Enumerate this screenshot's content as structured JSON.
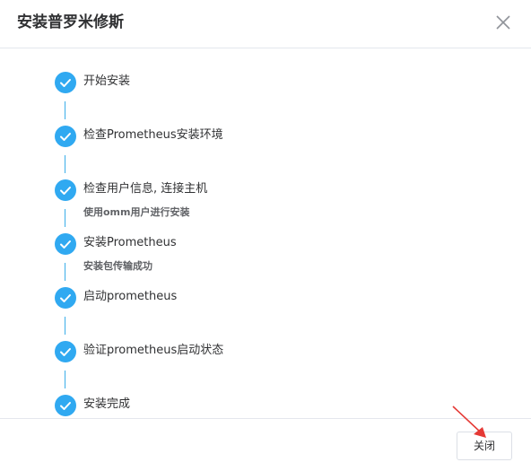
{
  "dialog": {
    "title": "安装普罗米修斯",
    "close_icon": "close-icon"
  },
  "steps": [
    {
      "title": "开始安装",
      "description": "",
      "status": "done"
    },
    {
      "title": "检查Prometheus安装环境",
      "description": "",
      "status": "done"
    },
    {
      "title": "检查用户信息, 连接主机",
      "description": "使用omm用户进行安装",
      "status": "done"
    },
    {
      "title": "安装Prometheus",
      "description": "安装包传输成功",
      "status": "done"
    },
    {
      "title": "启动prometheus",
      "description": "",
      "status": "done"
    },
    {
      "title": "验证prometheus启动状态",
      "description": "",
      "status": "done"
    },
    {
      "title": "安装完成",
      "description": "",
      "status": "done"
    }
  ],
  "footer": {
    "close_label": "关闭"
  },
  "colors": {
    "step_done": "#30a9f1",
    "connector": "#3aaee9",
    "annotation_arrow": "#e53935"
  }
}
